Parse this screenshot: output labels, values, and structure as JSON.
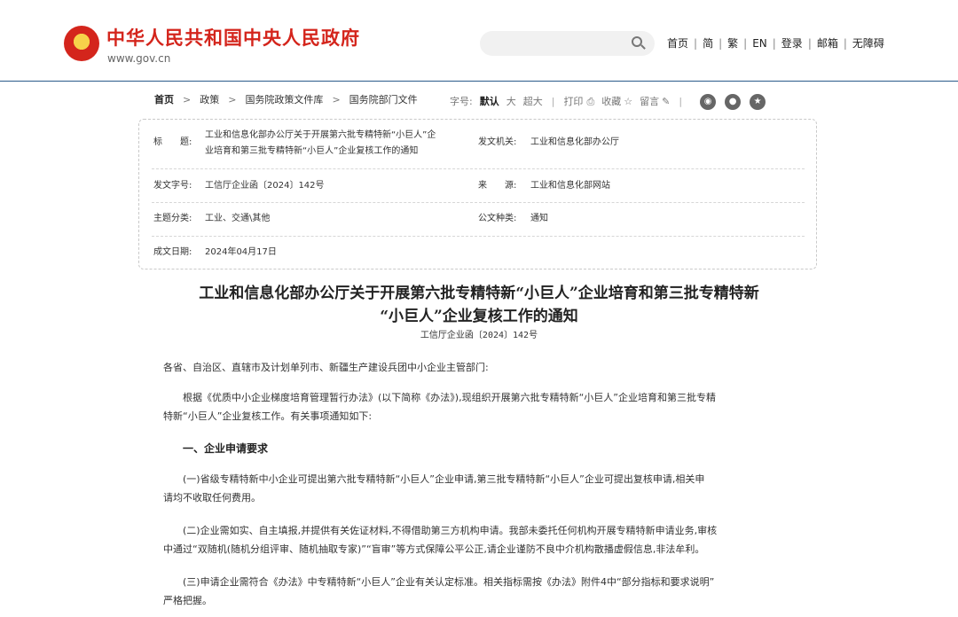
{
  "header": {
    "site_title": "中华人民共和国中央人民政府",
    "site_url": "www.gov.cn",
    "emblem_star": "★",
    "nav": [
      "首页",
      "简",
      "繁",
      "EN",
      "登录",
      "邮箱",
      "无障碍"
    ]
  },
  "breadcrumb": {
    "items": [
      "首页",
      "政策",
      "国务院政策文件库",
      "国务院部门文件"
    ],
    "separator": ">"
  },
  "tools": {
    "font_size_label": "字号:",
    "font_default": "默认",
    "font_large": "大",
    "font_xlarge": "超大",
    "print": "打印",
    "favorite": "收藏",
    "comment": "留言",
    "divider": "|",
    "share_icons": [
      "weibo-icon",
      "wechat-icon",
      "qzone-icon"
    ]
  },
  "meta": {
    "title_label": "标　　题:",
    "title_line1": "工业和信息化部办公厅关于开展第六批专精特新“小巨人”企",
    "title_line2": "业培育和第三批专精特新“小巨人”企业复核工作的通知",
    "issuer_label": "发文机关:",
    "issuer": "工业和信息化部办公厅",
    "docno_label": "发文字号:",
    "docno": "工信厅企业函〔2024〕142号",
    "source_label": "来　　源:",
    "source": "工业和信息化部网站",
    "category_label": "主题分类:",
    "category": "工业、交通\\其他",
    "type_label": "公文种类:",
    "type": "通知",
    "date_label": "成文日期:",
    "date": "2024年04月17日"
  },
  "article": {
    "title_line1": "工业和信息化部办公厅关于开展第六批专精特新“小巨人”企业培育和第三批专精特新",
    "title_line2": "“小巨人”企业复核工作的通知",
    "docno": "工信厅企业函〔2024〕142号",
    "salutation": "各省、自治区、直辖市及计划单列市、新疆生产建设兵团中小企业主管部门:",
    "intro_line1": "　　根据《优质中小企业梯度培育管理暂行办法》(以下简称《办法》),现组织开展第六批专精特新“小巨人”企业培育和第三批专精",
    "intro_line2": "特新“小巨人”企业复核工作。有关事项通知如下:",
    "section1": "一、企业申请要求",
    "p1_line1": "　　(一)省级专精特新中小企业可提出第六批专精特新“小巨人”企业申请,第三批专精特新“小巨人”企业可提出复核申请,相关申",
    "p1_line2": "请均不收取任何费用。",
    "p2_line1": "　　(二)企业需如实、自主填报,并提供有关佐证材料,不得借助第三方机构申请。我部未委托任何机构开展专精特新申请业务,审核",
    "p2_line2": "中通过“双随机(随机分组评审、随机抽取专家)”“盲审”等方式保障公平公正,请企业谨防不良中介机构散播虚假信息,非法牟利。",
    "p3_line1": "　　(三)申请企业需符合《办法》中专精特新“小巨人”企业有关认定标准。相关指标需按《办法》附件4中“部分指标和要求说明”",
    "p3_line2": "严格把握。"
  }
}
